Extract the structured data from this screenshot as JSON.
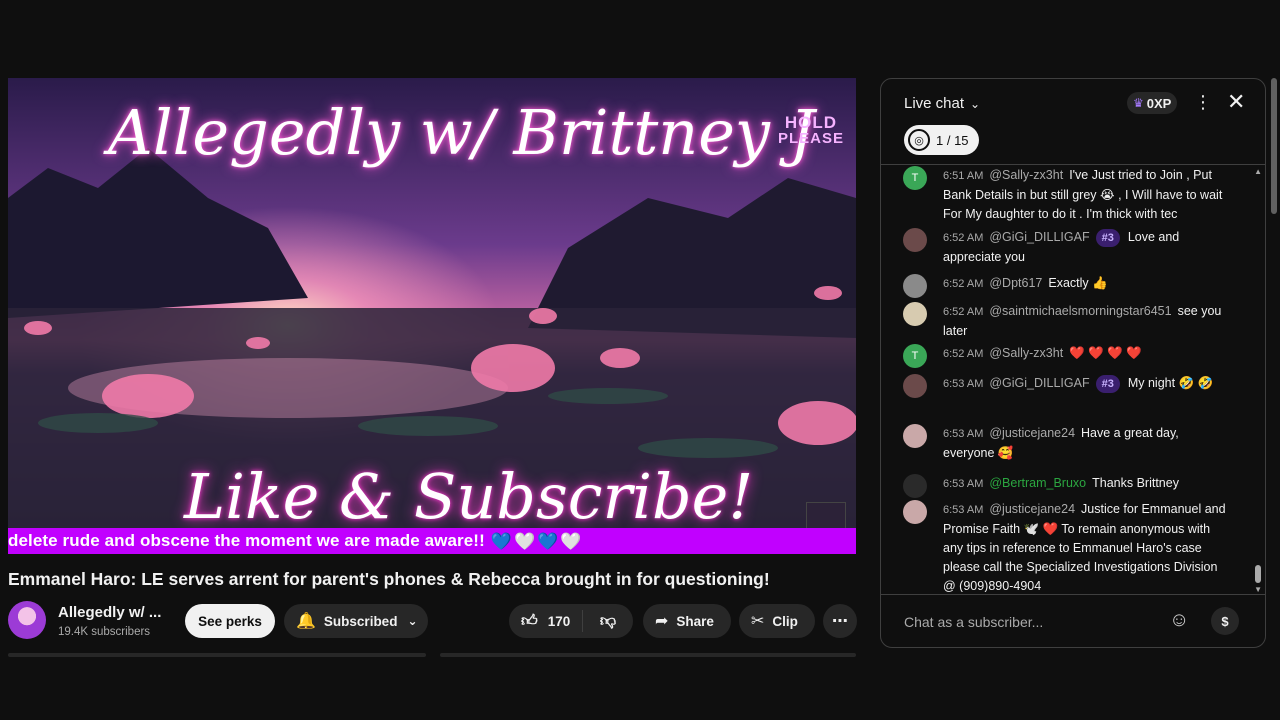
{
  "player": {
    "overlay_title": "Allegedly w/ Brittney J",
    "hold_line1": "HOLD",
    "hold_line2": "PLEASE",
    "like_subscribe": "Like & Subscribe!",
    "ticker_text": "delete rude and obscene the moment we are made aware!!",
    "ticker_hearts": [
      "💙",
      "🤍",
      "💙",
      "🤍"
    ],
    "colors": {
      "ticker": "#c100ff",
      "accent_pink": "#ff5ad7"
    }
  },
  "video": {
    "title": "Emmanel Haro: LE serves arrent for parent's phones & Rebecca brought in for questioning!",
    "channel_name": "Allegedly w/ ...",
    "subscribers": "19.4K subscribers",
    "see_perks": "See perks",
    "subscribed": "Subscribed",
    "like_count": "170",
    "share": "Share",
    "clip": "Clip",
    "icons": {
      "bell": "bell-icon",
      "like": "thumbs-up-icon",
      "dislike": "thumbs-down-icon",
      "share": "share-arrow-icon",
      "clip": "scissors-icon",
      "more": "more-horizontal-icon"
    }
  },
  "chat": {
    "title": "Live chat",
    "xp": "0XP",
    "poll": "1 / 15",
    "input_placeholder": "Chat as a subscriber...",
    "messages": [
      {
        "time": "6:51 AM",
        "author": "@Sally-zx3ht",
        "avatar_letter": "T",
        "avatar_color": "#3aa757",
        "text": "I've Just tried to Join , Put Bank Details in but still grey 😭 , I Will have to wait For My daughter to do it . I'm thick with tec"
      },
      {
        "time": "6:52 AM",
        "author": "@GiGi_DILLIGAF",
        "avatar_letter": "",
        "avatar_color": "#6b4a4a",
        "badge": "#3",
        "text": "Love and appreciate you"
      },
      {
        "time": "6:52 AM",
        "author": "@Dpt617",
        "avatar_letter": "",
        "avatar_color": "#8a8a8a",
        "text": "Exactly 👍"
      },
      {
        "time": "6:52 AM",
        "author": "@saintmichaelsmorningstar6451",
        "avatar_letter": "",
        "avatar_color": "#d7cbb0",
        "text": "see you later"
      },
      {
        "time": "6:52 AM",
        "author": "@Sally-zx3ht",
        "avatar_letter": "T",
        "avatar_color": "#3aa757",
        "text": "❤️ ❤️ ❤️ ❤️"
      },
      {
        "time": "6:53 AM",
        "author": "@GiGi_DILLIGAF",
        "avatar_letter": "",
        "avatar_color": "#6b4a4a",
        "badge": "#3",
        "text": "My night 🤣 🤣"
      },
      {
        "time": "6:53 AM",
        "author": "@justicejane24",
        "avatar_letter": "",
        "avatar_color": "#c9a8a8",
        "text": "Have a great day, everyone 🥰"
      },
      {
        "time": "6:53 AM",
        "author": "@Bertram_Bruxo",
        "avatar_letter": "",
        "avatar_color": "#2a2a2a",
        "member": true,
        "text": "Thanks Brittney"
      },
      {
        "time": "6:53 AM",
        "author": "@justicejane24",
        "avatar_letter": "",
        "avatar_color": "#c9a8a8",
        "text": "Justice for Emmanuel and Promise Faith 🕊️ ❤️ To remain anonymous with any tips in reference to Emmanuel Haro's case please call the Specialized Investigations Division @ (909)890-4904"
      }
    ]
  }
}
